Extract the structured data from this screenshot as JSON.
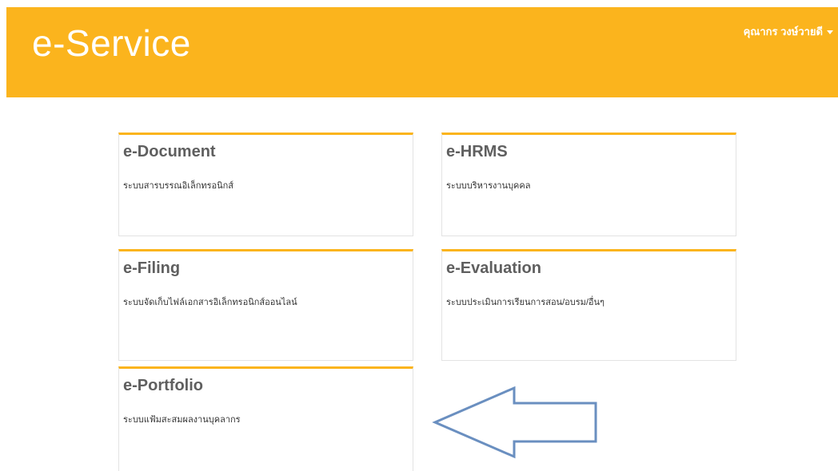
{
  "header": {
    "brand": "e-Service",
    "user_name": "คุณากร วงษ์วายดี"
  },
  "services": [
    {
      "title": "e-Document",
      "description": "ระบบสารบรรณอิเล็กทรอนิกส์"
    },
    {
      "title": "e-HRMS",
      "description": "ระบบบริหารงานบุคคล"
    },
    {
      "title": "e-Filing",
      "description": "ระบบจัดเก็บไฟล์เอกสารอิเล็กทรอนิกส์ออนไลน์"
    },
    {
      "title": "e-Evaluation",
      "description": "ระบบประเมินการเรียนการสอน/อบรม/อื่นๆ"
    },
    {
      "title": "e-Portfolio",
      "description": "ระบบแฟ้มสะสมผลงานบุคลากร"
    }
  ],
  "colors": {
    "header_bg": "#fbb41d",
    "card_accent": "#fbb41d",
    "arrow_stroke": "#6a8fc0"
  },
  "annotation": {
    "arrow_icon": "left-arrow-icon",
    "points_to": "e-Portfolio"
  }
}
